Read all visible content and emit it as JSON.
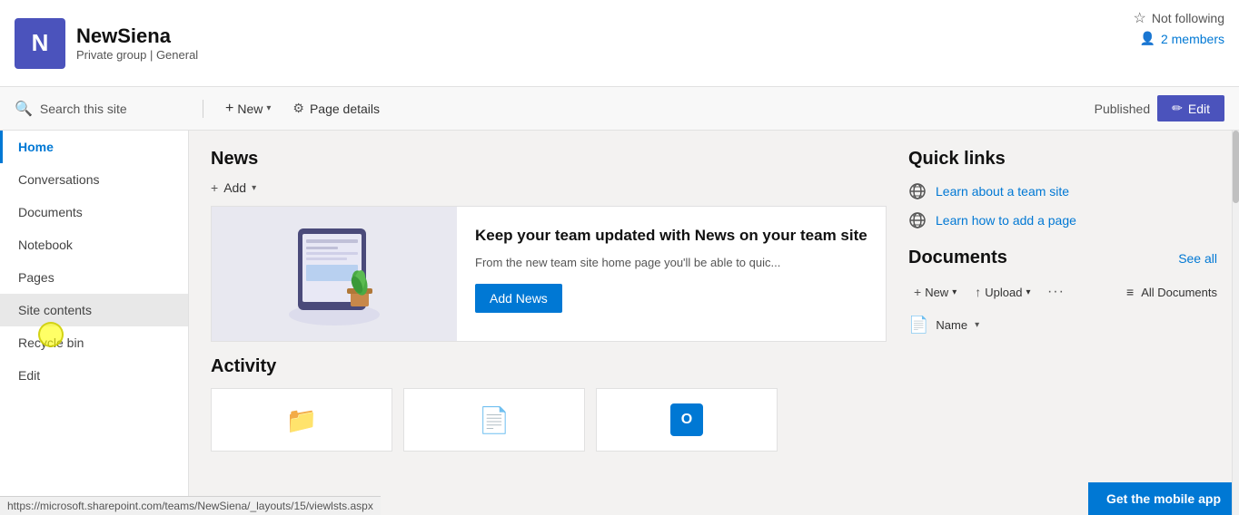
{
  "header": {
    "site_icon_letter": "N",
    "site_title": "NewSiena",
    "site_subtitle_type": "Private group",
    "site_subtitle_sep": " | ",
    "site_subtitle_name": "General",
    "not_following_label": "Not following",
    "members_label": "2 members"
  },
  "toolbar": {
    "search_placeholder": "Search this site",
    "new_label": "New",
    "page_details_label": "Page details",
    "published_label": "Published",
    "edit_label": "Edit"
  },
  "sidebar": {
    "items": [
      {
        "label": "Home",
        "active": true
      },
      {
        "label": "Conversations",
        "active": false
      },
      {
        "label": "Documents",
        "active": false
      },
      {
        "label": "Notebook",
        "active": false
      },
      {
        "label": "Pages",
        "active": false
      },
      {
        "label": "Site contents",
        "active": false,
        "hovered": true
      },
      {
        "label": "Recycle bin",
        "active": false
      },
      {
        "label": "Edit",
        "active": false
      }
    ]
  },
  "news": {
    "section_title": "News",
    "add_label": "Add",
    "card": {
      "heading": "Keep your team updated with News on your team site",
      "description": "From the new team site home page you'll be able to quic...",
      "button_label": "Add News"
    }
  },
  "activity": {
    "section_title": "Activity"
  },
  "quick_links": {
    "section_title": "Quick links",
    "items": [
      {
        "label": "Learn about a team site"
      },
      {
        "label": "Learn how to add a page"
      }
    ]
  },
  "documents": {
    "section_title": "Documents",
    "see_all_label": "See all",
    "new_label": "New",
    "upload_label": "Upload",
    "all_docs_label": "All Documents",
    "name_label": "Name"
  },
  "status_bar": {
    "url": "https://microsoft.sharepoint.com/teams/NewSiena/_layouts/15/viewlsts.aspx"
  },
  "mobile_app": {
    "button_label": "Get the mobile app"
  }
}
